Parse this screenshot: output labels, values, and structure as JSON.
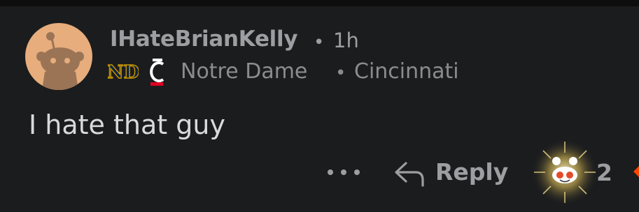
{
  "comment": {
    "username": "IHateBrianKelly",
    "separator": "•",
    "time": "1h",
    "flairs": {
      "team_primary": "Notre Dame",
      "separator": "•",
      "team_secondary": "Cincinnati",
      "primary_icon": "notre-dame-logo-icon",
      "secondary_icon": "cincinnati-logo-icon"
    },
    "body": "I hate that guy",
    "actions": {
      "more_icon": "ellipsis-icon",
      "reply_label": "Reply",
      "reply_icon": "reply-arrow-icon",
      "award_icon": "reddit-award-icon",
      "vote_count": "2",
      "upvote_icon": "upvote-icon"
    }
  },
  "colors": {
    "background": "#1b1c1e",
    "meta_text": "#9c9ea2",
    "body_text": "#d7dadc",
    "avatar_bg": "#e7ad7c",
    "nd_gold": "#c99700",
    "uc_red": "#e00122",
    "upvote_orange": "#ff4500"
  }
}
